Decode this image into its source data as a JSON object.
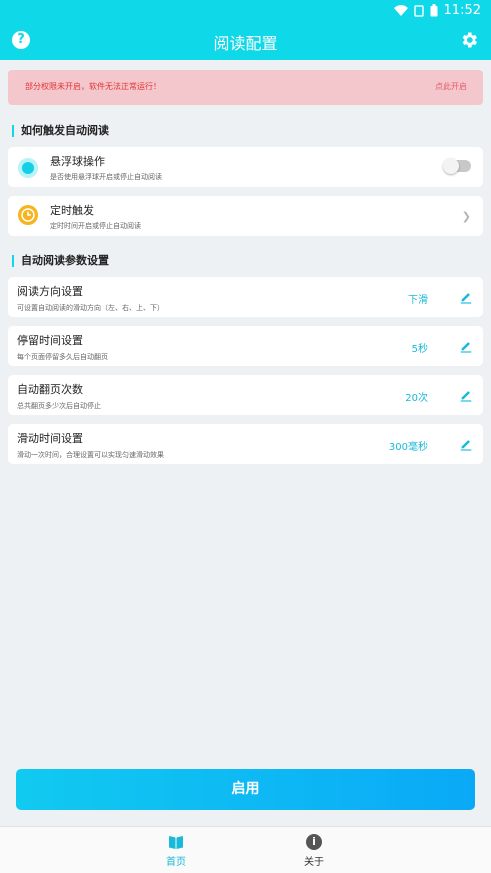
{
  "status_bar": {
    "time": "11:52"
  },
  "app_bar": {
    "title": "阅读配置",
    "help_icon": "help-icon",
    "settings_icon": "gear-icon"
  },
  "warning": {
    "message": "部分权限未开启，软件无法正常运行！",
    "action": "点此开启"
  },
  "sections": {
    "trigger_title": "如何触发自动阅读",
    "params_title": "自动阅读参数设置"
  },
  "trigger_items": [
    {
      "title": "悬浮球操作",
      "subtitle": "是否使用悬浮球开启或停止自动阅读",
      "toggle_on": false
    },
    {
      "title": "定时触发",
      "subtitle": "定时时间开启或停止自动阅读"
    }
  ],
  "params": [
    {
      "title": "阅读方向设置",
      "subtitle": "可设置自动阅读的滑动方向（左、右、上、下）",
      "value": "下滑"
    },
    {
      "title": "停留时间设置",
      "subtitle": "每个页面停留多久后自动翻页",
      "value": "5秒"
    },
    {
      "title": "自动翻页次数",
      "subtitle": "总共翻页多少次后自动停止",
      "value": "20次"
    },
    {
      "title": "滑动时间设置",
      "subtitle": "滑动一次时间，合理设置可以实现匀速滑动效果",
      "value": "300毫秒"
    }
  ],
  "primary_button": "启用",
  "bottom_nav": [
    {
      "label": "首页",
      "active": true,
      "color": "#19b9d8"
    },
    {
      "label": "关于",
      "active": false,
      "color": "#333333"
    }
  ],
  "colors": {
    "accent": "#0fd9e8",
    "warning_bg": "#f4c7cc",
    "warning_text": "#e13535"
  }
}
